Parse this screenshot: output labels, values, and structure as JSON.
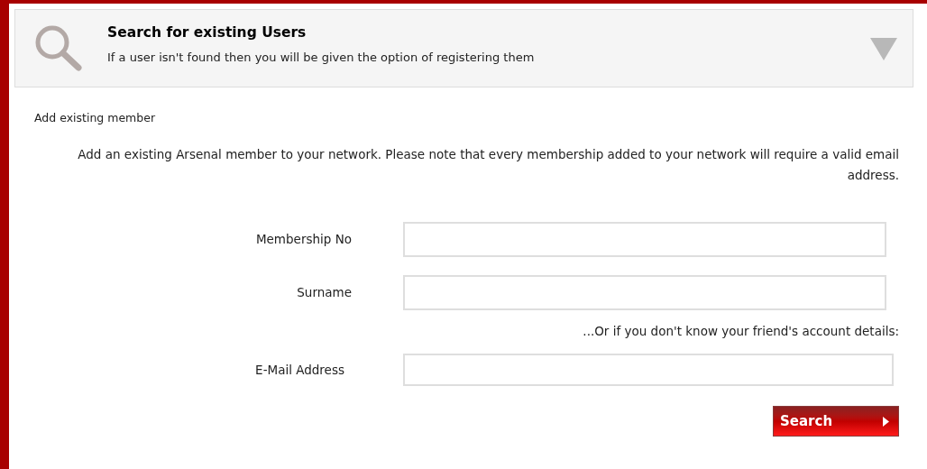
{
  "header": {
    "title": "Search for existing Users",
    "subtitle": "If a user isn't found then you will be given the option of registering them",
    "expanded": true
  },
  "section_title": "Add existing member",
  "intro": "Add an existing Arsenal member to your network. Please note that every membership added to your network will require a valid email address.",
  "form": [
    {
      "kind": "field",
      "label": "Membership No"
    },
    {
      "kind": "field",
      "label": "Surname"
    },
    {
      "kind": "note",
      "text": "...Or if you don't know your friend's account details:"
    },
    {
      "kind": "wide_field",
      "label": "E-Mail Address"
    }
  ],
  "button": "Search"
}
